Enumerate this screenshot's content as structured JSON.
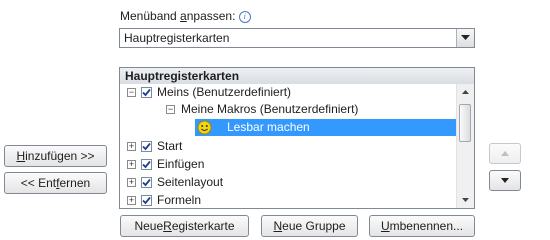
{
  "customize": {
    "label_pre": "Menüband ",
    "label_u": "a",
    "label_post": "npassen:",
    "info_icon": "info-icon",
    "combo_value": "Hauptregisterkarten"
  },
  "tree": {
    "header": "Hauptregisterkarten",
    "items": [
      {
        "label": "Meins (Benutzerdefiniert)",
        "expanded": true,
        "checked": true
      },
      {
        "label": "Meine Makros (Benutzerdefiniert)",
        "expanded": true
      },
      {
        "label": "Lesbar machen",
        "icon": "smiley-icon",
        "selected": true
      },
      {
        "label": "Start",
        "expanded": false,
        "checked": true
      },
      {
        "label": "Einfügen",
        "expanded": false,
        "checked": true
      },
      {
        "label": "Seitenlayout",
        "expanded": false,
        "checked": true
      },
      {
        "label": "Formeln",
        "expanded": false,
        "checked": true
      }
    ]
  },
  "buttons": {
    "add": {
      "pre": "",
      "u": "H",
      "post": "inzufügen >>"
    },
    "remove": {
      "pre": "<< Ent",
      "u": "f",
      "post": "ernen"
    },
    "new_tab": {
      "pre": "Neue ",
      "u": "R",
      "post": "egisterkarte"
    },
    "new_group": {
      "pre": "",
      "u": "N",
      "post": "eue Gruppe"
    },
    "rename": {
      "pre": "",
      "u": "U",
      "post": "mbenennen..."
    }
  },
  "colors": {
    "selection": "#3399ff",
    "check": "#1f3f8f"
  }
}
